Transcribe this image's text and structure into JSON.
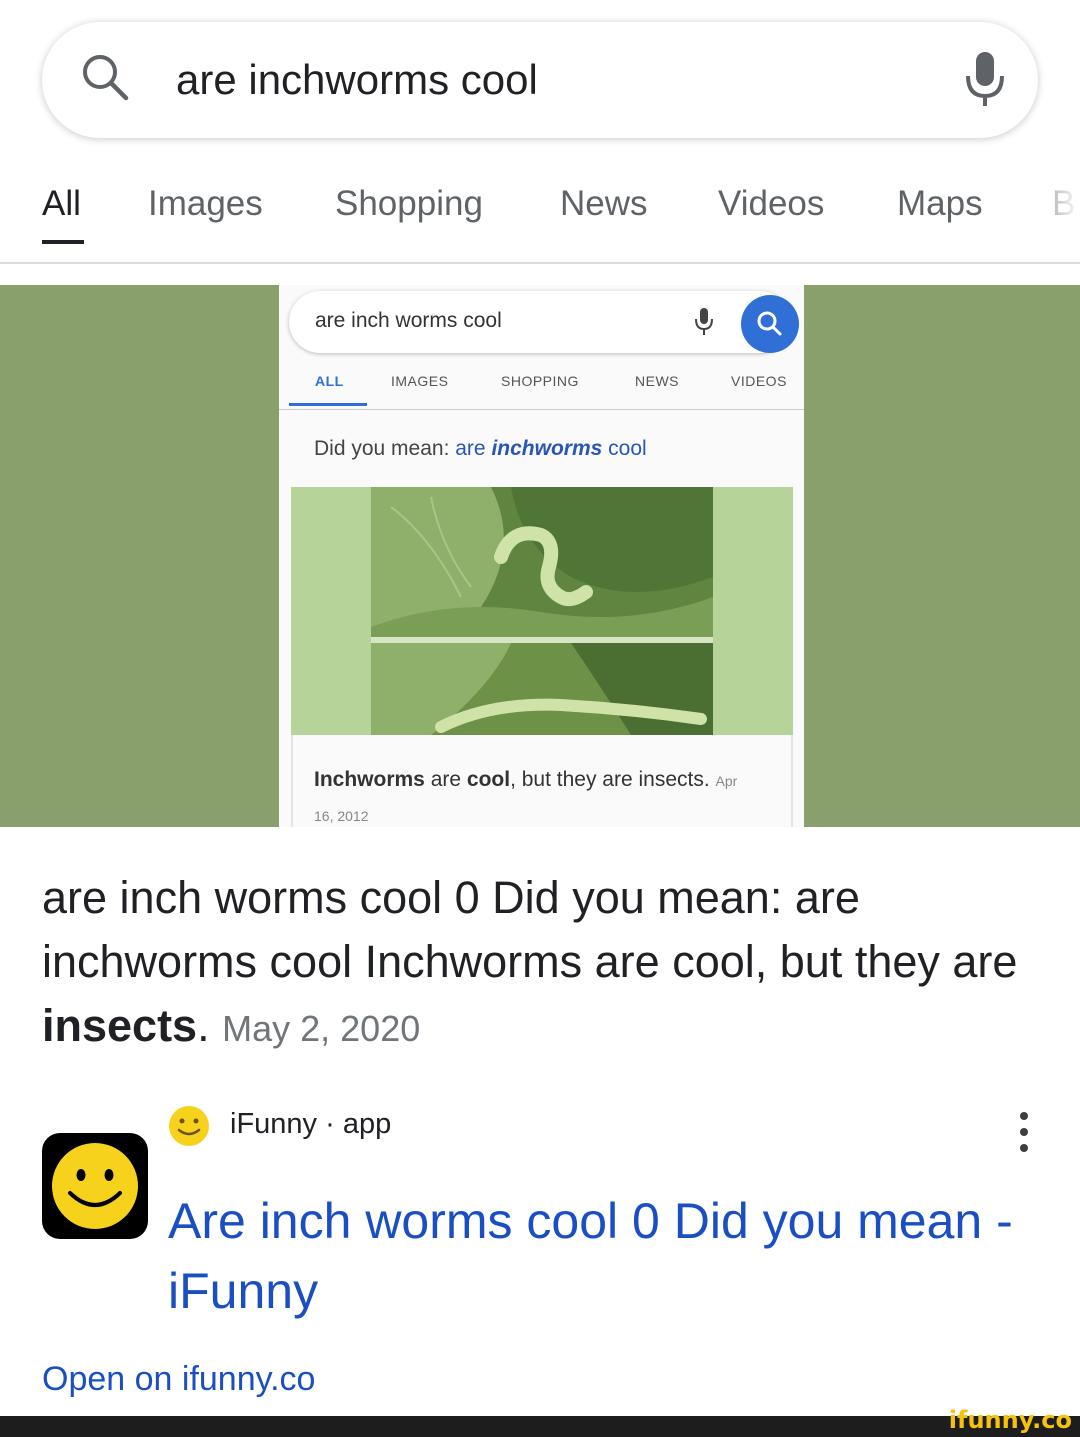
{
  "search": {
    "query": "are inchworms cool"
  },
  "tabs": [
    {
      "label": "All",
      "active": true
    },
    {
      "label": "Images"
    },
    {
      "label": "Shopping"
    },
    {
      "label": "News"
    },
    {
      "label": "Videos"
    },
    {
      "label": "Maps"
    },
    {
      "label": "B"
    }
  ],
  "image_panel": {
    "background": "#8aa06c",
    "inner": {
      "query": "are inch worms cool",
      "tabs": [
        "ALL",
        "IMAGES",
        "SHOPPING",
        "NEWS",
        "VIDEOS"
      ],
      "did_you_mean_prefix": "Did you mean:",
      "did_you_mean_are": "are",
      "did_you_mean_word": "inchworms",
      "did_you_mean_suffix": "cool",
      "caption_bold1": "Inchworms",
      "caption_mid": "are",
      "caption_bold2": "cool",
      "caption_rest": ", but they are insects.",
      "caption_date": "Apr 16, 2012"
    }
  },
  "snippet": {
    "text": "are inch worms cool 0 Did you mean: are inchworms cool Inchworms are cool, but they are",
    "bold": "insects",
    "end": ".",
    "date": "May 2, 2020"
  },
  "source": {
    "name": "iFunny · app"
  },
  "result": {
    "title": "Are inch worms cool 0 Did you mean - iFunny",
    "link_text": "Open on ifunny.co"
  },
  "watermark": "ifunny.co",
  "colors": {
    "link_blue": "#1a4fc4",
    "panel_green": "#8aa06c",
    "smiley_yellow": "#f6d21c"
  }
}
